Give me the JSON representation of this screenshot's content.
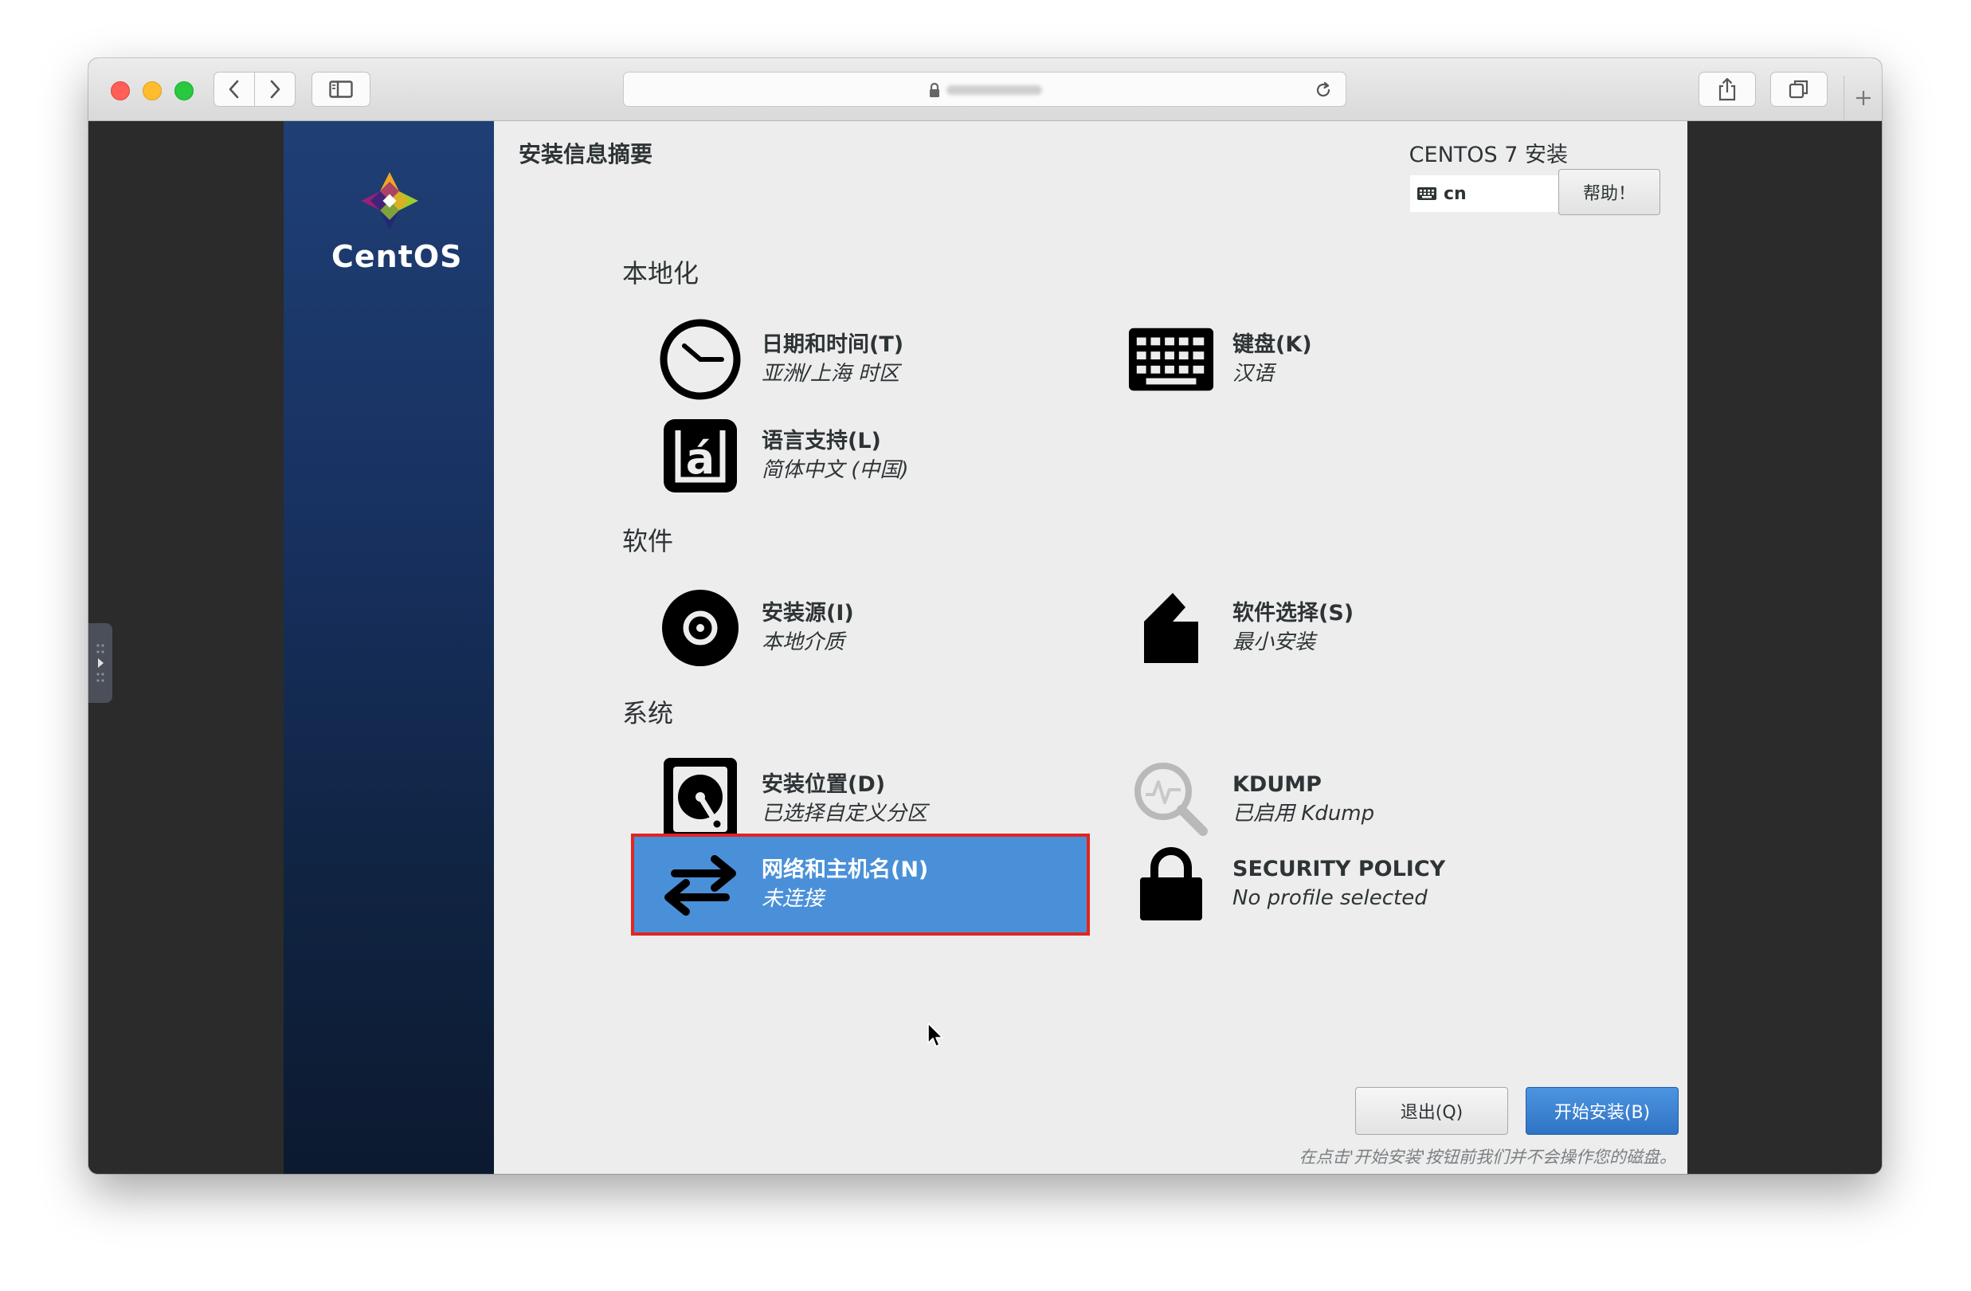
{
  "browser": {
    "icons": {
      "back": "chevron-left-icon",
      "forward": "chevron-right-icon",
      "sidebar": "sidebar-icon",
      "lock": "lock-icon",
      "reload": "reload-icon",
      "share": "share-icon",
      "tabs": "tabs-icon",
      "new_tab": "plus-icon"
    }
  },
  "installer": {
    "brand": "CentOS",
    "page_title": "安装信息摘要",
    "product_title": "CENTOS 7 安装",
    "keyboard_layout": "cn",
    "help_label": "帮助！",
    "sections": {
      "localization": {
        "title": "本地化",
        "date_time": {
          "name": "日期和时间(T)",
          "status": "亚洲/上海 时区"
        },
        "keyboard": {
          "name": "键盘(K)",
          "status": "汉语"
        },
        "language": {
          "name": "语言支持(L)",
          "status": "简体中文 (中国)"
        }
      },
      "software": {
        "title": "软件",
        "source": {
          "name": "安装源(I)",
          "status": "本地介质"
        },
        "selection": {
          "name": "软件选择(S)",
          "status": "最小安装"
        }
      },
      "system": {
        "title": "系统",
        "destination": {
          "name": "安装位置(D)",
          "status": "已选择自定义分区"
        },
        "kdump": {
          "name": "KDUMP",
          "status": "已启用 Kdump"
        },
        "network": {
          "name": "网络和主机名(N)",
          "status": "未连接",
          "selected": true
        },
        "security": {
          "name": "SECURITY POLICY",
          "status": "No profile selected"
        }
      }
    },
    "quit_label": "退出(Q)",
    "begin_label": "开始安装(B)",
    "footnote": "在点击'开始安装'按钮前我们并不会操作您的磁盘。"
  },
  "colors": {
    "selected": "#4a90d9",
    "highlight_box": "#e0261f",
    "primary_button": "#3a82d0",
    "side_panel": "#183262"
  }
}
